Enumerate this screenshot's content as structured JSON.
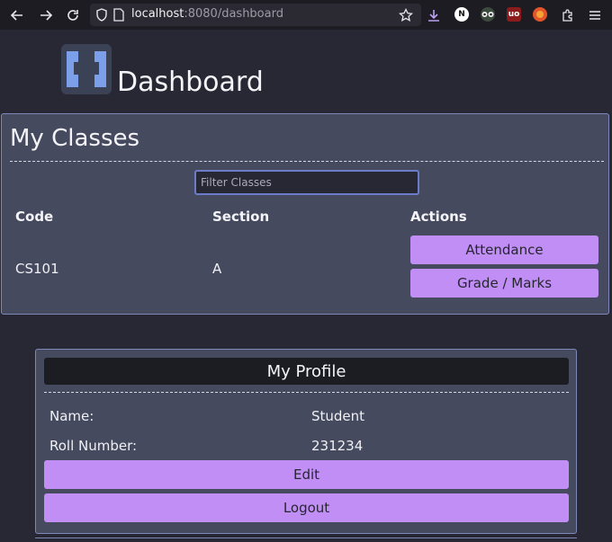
{
  "browser": {
    "url_host": "localhost",
    "url_rest": ":8080/dashboard"
  },
  "page": {
    "title": "Dashboard"
  },
  "classes": {
    "title": "My Classes",
    "filter_placeholder": "Filter Classes",
    "columns": [
      "Code",
      "Section",
      "Actions"
    ],
    "rows": [
      {
        "code": "CS101",
        "section": "A",
        "actions": [
          "Attendance",
          "Grade / Marks"
        ]
      }
    ]
  },
  "profile": {
    "title": "My Profile",
    "fields": [
      {
        "label": "Name:",
        "value": "Student"
      },
      {
        "label": "Roll Number:",
        "value": "231234"
      }
    ],
    "edit_label": "Edit",
    "logout_label": "Logout"
  },
  "colors": {
    "background": "#272833",
    "card": "#454a5f",
    "card_border": "#7e88b8",
    "button": "#c18ef6",
    "logo_blue": "#7b9fe9"
  },
  "icons": [
    "back-arrow-icon",
    "forward-arrow-icon",
    "reload-icon",
    "shield-icon",
    "page-icon",
    "star-icon",
    "download-icon",
    "notion-extension-icon",
    "privacy-badger-icon",
    "ublock-icon",
    "firefox-extension-icon",
    "extensions-puzzle-icon",
    "hamburger-menu-icon"
  ]
}
